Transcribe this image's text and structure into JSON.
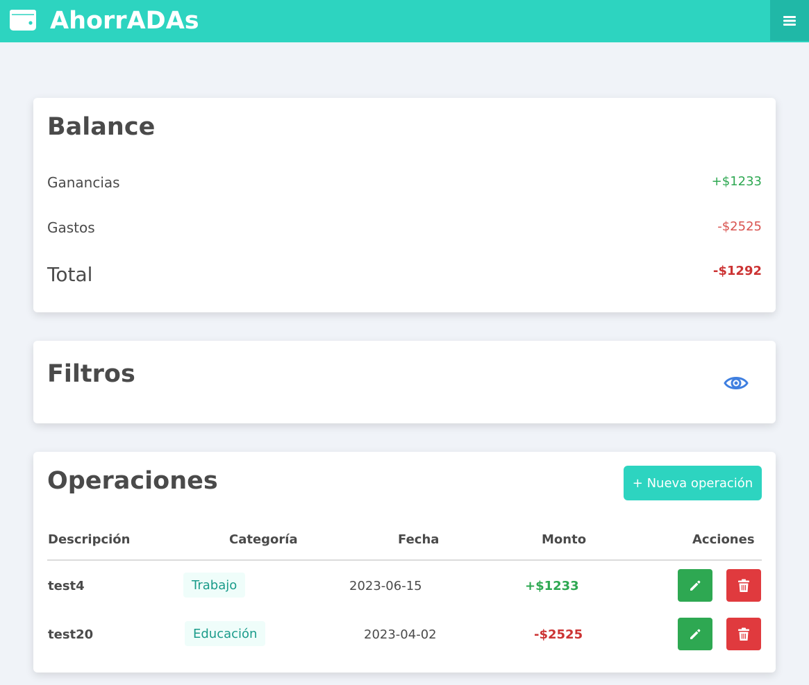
{
  "navbar": {
    "title": "AhorrADAs",
    "logo_icon": "wallet-icon",
    "menu_icon": "hamburger-icon",
    "color": "#2dd4c0"
  },
  "balance": {
    "title": "Balance",
    "ganancias_label": "Ganancias",
    "ganancias_value": "+$1233",
    "gastos_label": "Gastos",
    "gastos_value": "-$2525",
    "total_label": "Total",
    "total_value": "-$1292"
  },
  "filters": {
    "title": "Filtros",
    "toggle_icon": "eye-icon"
  },
  "operations": {
    "title": "Operaciones",
    "new_button": "+ Nueva operación",
    "columns": [
      "Descripción",
      "Categoría",
      "Fecha",
      "Monto",
      "Acciones"
    ],
    "rows": [
      {
        "description": "test4",
        "category": "Trabajo",
        "date": "2023-06-15",
        "amount": "+$1233",
        "type": "gain"
      },
      {
        "description": "test20",
        "category": "Educación",
        "date": "2023-04-02",
        "amount": "-$2525",
        "type": "expense"
      }
    ],
    "edit_icon": "pencil-icon",
    "delete_icon": "trash-icon"
  },
  "colors": {
    "gain": "#2ea852",
    "expense": "#cc3333",
    "accent": "#2dd4c0"
  }
}
